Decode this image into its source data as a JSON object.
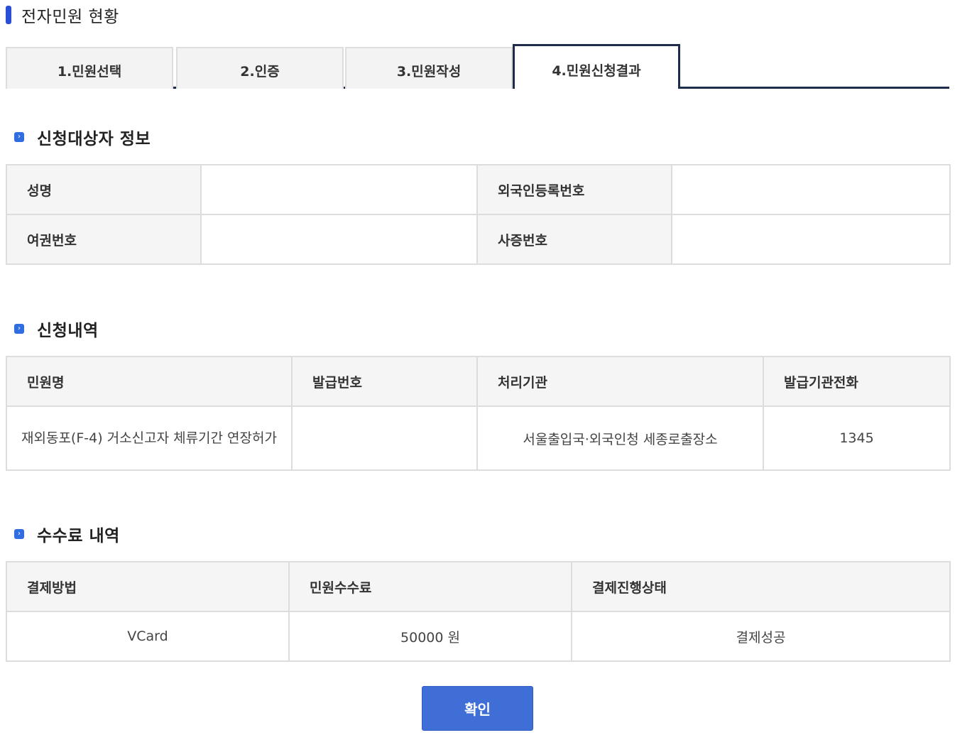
{
  "page": {
    "title": "전자민원 현황",
    "accent_color": "#2a4fd6",
    "tab_border_color": "#1f2d4d",
    "button_color": "#3f6fd6"
  },
  "tabs": [
    {
      "label": "1.민원선택",
      "active": false
    },
    {
      "label": "2.인증",
      "active": false
    },
    {
      "label": "3.민원작성",
      "active": false
    },
    {
      "label": "4.민원신청결과",
      "active": true
    }
  ],
  "applicant": {
    "title": "신청대상자 정보",
    "name_label": "성명",
    "name_value": "",
    "alien_reg_label": "외국인등록번호",
    "alien_reg_value": "",
    "passport_label": "여권번호",
    "passport_value": "",
    "visa_label": "사증번호",
    "visa_value": ""
  },
  "application": {
    "title": "신청내역",
    "headers": [
      "민원명",
      "발급번호",
      "처리기관",
      "발급기관전화"
    ],
    "row": {
      "name": "재외동포(F-4) 거소신고자 체류기간 연장허가",
      "issue_no": "",
      "office": "서울출입국·외국인청 세종로출장소",
      "phone": "1345"
    }
  },
  "fees": {
    "title": "수수료 내역",
    "headers": [
      "결제방법",
      "민원수수료",
      "결제진행상태"
    ],
    "row": {
      "method": "VCard",
      "amount": "50000 원",
      "status": "결제성공"
    }
  },
  "confirm_label": "확인"
}
